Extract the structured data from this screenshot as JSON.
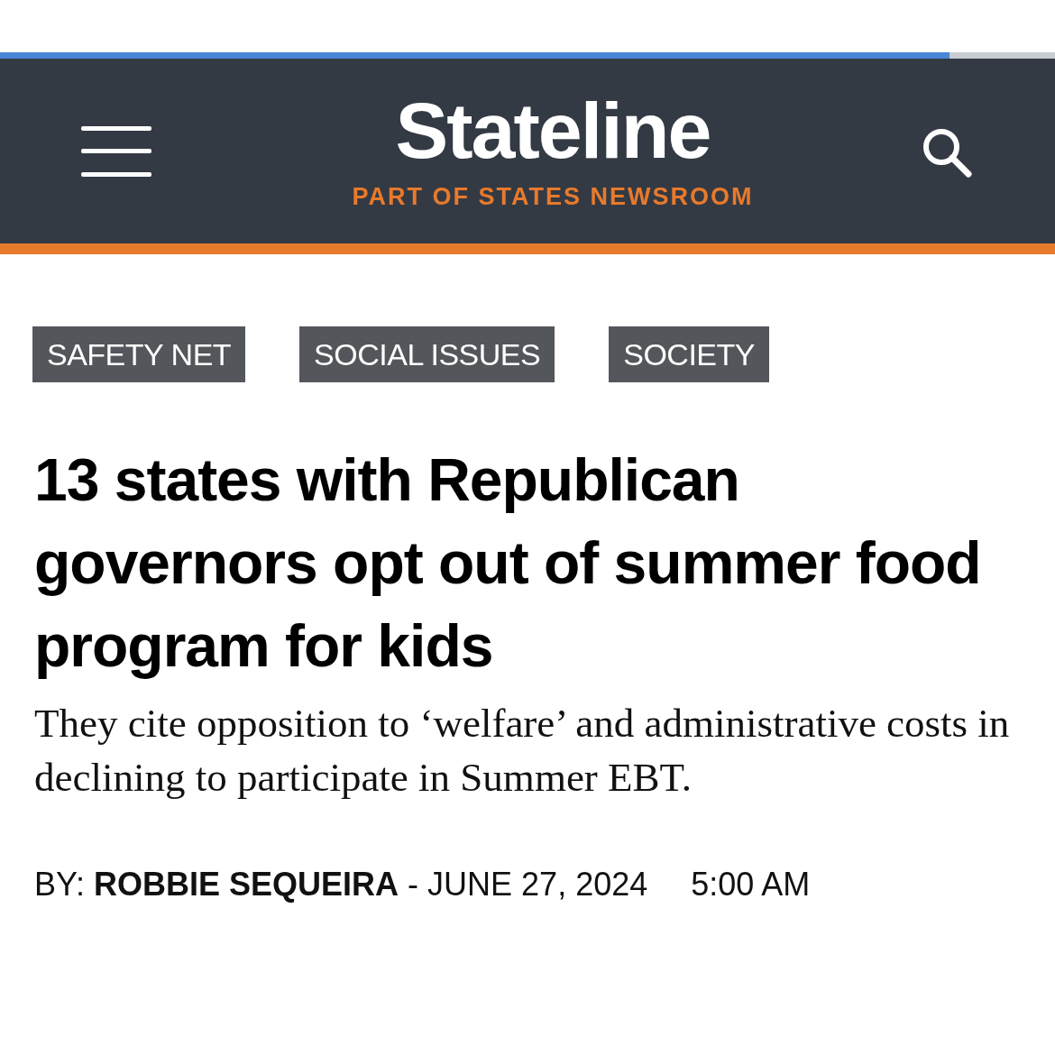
{
  "progress": {
    "level": 0.9
  },
  "header": {
    "logo": "Stateline",
    "tagline": "PART OF STATES NEWSROOM"
  },
  "tags": [
    {
      "label": "SAFETY NET"
    },
    {
      "label": "SOCIAL ISSUES"
    },
    {
      "label": "SOCIETY"
    }
  ],
  "headline": "13 states with Republican governors opt out of summer food program for kids",
  "dek": "They cite opposition to ‘welfare’ and administrative costs in declining to participate in Summer EBT.",
  "byline": {
    "prefix": "BY:",
    "author": "ROBBIE SEQUEIRA",
    "date": "- JUNE 27, 2024",
    "time": "5:00 AM"
  }
}
